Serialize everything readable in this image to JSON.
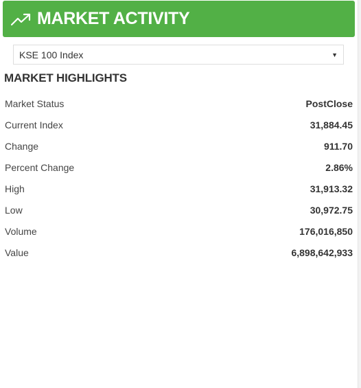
{
  "header": {
    "icon": "trending-up-icon",
    "title": "MARKET ACTIVITY",
    "color": "#52b046"
  },
  "index_select": {
    "selected": "KSE 100 Index"
  },
  "highlights": {
    "title": "MARKET HIGHLIGHTS",
    "rows": [
      {
        "label": "Market Status",
        "value": "PostClose"
      },
      {
        "label": "Current Index",
        "value": "31,884.45"
      },
      {
        "label": "Change",
        "value": "911.70"
      },
      {
        "label": "Percent Change",
        "value": "2.86%"
      },
      {
        "label": "High",
        "value": "31,913.32"
      },
      {
        "label": "Low",
        "value": "30,972.75"
      },
      {
        "label": "Volume",
        "value": "176,016,850"
      },
      {
        "label": "Value",
        "value": "6,898,642,933"
      }
    ]
  }
}
